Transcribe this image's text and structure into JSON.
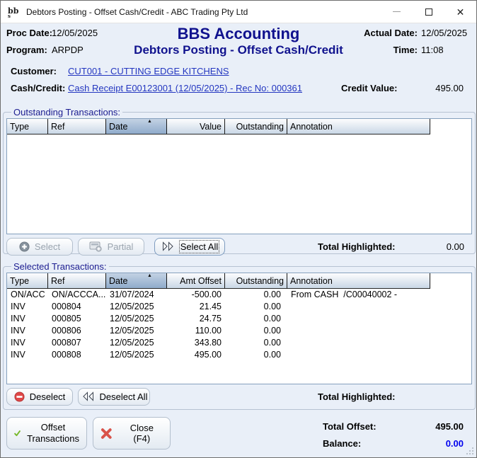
{
  "window": {
    "title": "Debtors Posting - Offset Cash/Credit - ABC Trading Pty Ltd",
    "icon": "bbs-logo"
  },
  "header": {
    "proc_date_label": "Proc Date:",
    "proc_date": "12/05/2025",
    "program_label": "Program:",
    "program": "ARPDP",
    "app_title": "BBS Accounting",
    "screen_title": "Debtors Posting - Offset Cash/Credit",
    "actual_date_label": "Actual Date:",
    "actual_date": "12/05/2025",
    "time_label": "Time:",
    "time": "11:08"
  },
  "context": {
    "customer_label": "Customer:",
    "customer_link": "CUT001 - CUTTING EDGE KITCHENS",
    "cash_credit_label": "Cash/Credit:",
    "cash_credit_link": "Cash Receipt E00123001 (12/05/2025) - Rec No: 000361",
    "credit_value_label": "Credit Value:",
    "credit_value": "495.00"
  },
  "outstanding": {
    "group_label": "Outstanding Transactions:",
    "columns": [
      "Type",
      "Ref",
      "Date",
      "Value",
      "Outstanding",
      "Annotation"
    ],
    "sorted_column": "Date",
    "sort_direction": "asc",
    "rows": [],
    "select_button": "Select",
    "partial_button": "Partial",
    "select_all_button": "Select All",
    "total_highlighted_label": "Total Highlighted:",
    "total_highlighted": "0.00"
  },
  "selected": {
    "group_label": "Selected Transactions:",
    "columns": [
      "Type",
      "Ref",
      "Date",
      "Amt Offset",
      "Outstanding",
      "Annotation"
    ],
    "sorted_column": "Date",
    "sort_direction": "asc",
    "rows": [
      {
        "type": "ON/ACC",
        "ref": "ON/ACCCA...",
        "date": "31/07/2024",
        "amt_offset": "-500.00",
        "outstanding": "0.00",
        "annotation": "From CASH  /C00040002 -"
      },
      {
        "type": "INV",
        "ref": "000804",
        "date": "12/05/2025",
        "amt_offset": "21.45",
        "outstanding": "0.00",
        "annotation": ""
      },
      {
        "type": "INV",
        "ref": "000805",
        "date": "12/05/2025",
        "amt_offset": "24.75",
        "outstanding": "0.00",
        "annotation": ""
      },
      {
        "type": "INV",
        "ref": "000806",
        "date": "12/05/2025",
        "amt_offset": "110.00",
        "outstanding": "0.00",
        "annotation": ""
      },
      {
        "type": "INV",
        "ref": "000807",
        "date": "12/05/2025",
        "amt_offset": "343.80",
        "outstanding": "0.00",
        "annotation": ""
      },
      {
        "type": "INV",
        "ref": "000808",
        "date": "12/05/2025",
        "amt_offset": "495.00",
        "outstanding": "0.00",
        "annotation": ""
      }
    ],
    "deselect_button": "Deselect",
    "deselect_all_button": "Deselect All",
    "total_highlighted_label": "Total Highlighted:",
    "total_highlighted": ""
  },
  "footer": {
    "offset_button_line1": "Offset",
    "offset_button_line2": "Transactions",
    "close_button": "Close (F4)",
    "total_offset_label": "Total Offset:",
    "total_offset": "495.00",
    "balance_label": "Balance:",
    "balance": "0.00"
  },
  "icons": {
    "select": "plus-circle",
    "partial": "keypad-plus",
    "select_all": "double-chevron-right",
    "deselect": "no-entry-circle",
    "deselect_all": "double-chevron-left",
    "offset": "green-check",
    "close": "red-cross",
    "sort": "up-triangle"
  },
  "colors": {
    "navy_heading": "#10128e",
    "link_blue": "#2336c0",
    "balance_blue": "#0000ee",
    "sorted_header_top": "#c3d2e4",
    "sorted_header_bottom": "#8fabcb",
    "deselect_red": "#e04848",
    "check_green": "#76b82a",
    "close_red": "#d9534a"
  }
}
